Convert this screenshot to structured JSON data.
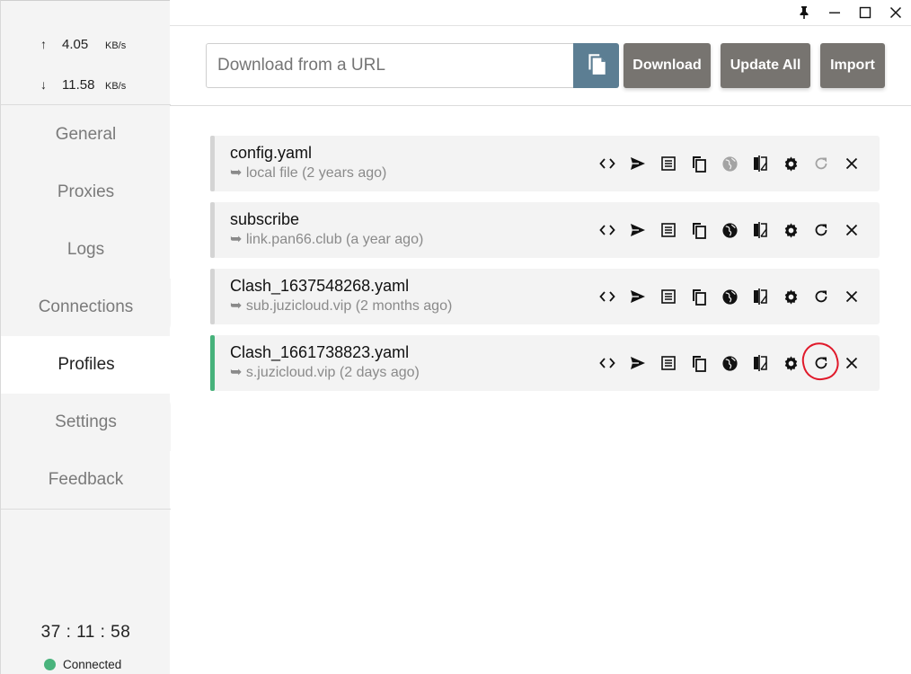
{
  "window": {
    "controls": [
      {
        "name": "pin-icon",
        "glyph": "📌"
      },
      {
        "name": "minimize-icon",
        "glyph": "—"
      },
      {
        "name": "maximize-icon",
        "glyph": "☐"
      },
      {
        "name": "close-icon",
        "glyph": "✕"
      }
    ]
  },
  "traffic": {
    "up_arrow": "↑",
    "up_value": "4.05",
    "up_unit": "KB/s",
    "down_arrow": "↓",
    "down_value": "11.58",
    "down_unit": "KB/s"
  },
  "nav": {
    "items": [
      {
        "label": "General"
      },
      {
        "label": "Proxies"
      },
      {
        "label": "Logs"
      },
      {
        "label": "Connections"
      },
      {
        "label": "Profiles"
      },
      {
        "label": "Settings"
      },
      {
        "label": "Feedback"
      }
    ],
    "active": "Profiles"
  },
  "footer": {
    "clock": "37 : 11 : 58",
    "status": "Connected",
    "status_color": "#49b37c"
  },
  "header": {
    "url_placeholder": "Download from a URL",
    "url_value": "",
    "download_label": "Download",
    "update_all_label": "Update All",
    "import_label": "Import",
    "accent_color": "#5c7e93",
    "button_color": "#777470"
  },
  "profiles": [
    {
      "name": "config.yaml",
      "source": "➥ local file (2 years ago)",
      "selected": false,
      "remote": false
    },
    {
      "name": "subscribe",
      "source": "➥ link.pan66.club (a year ago)",
      "selected": false,
      "remote": true
    },
    {
      "name": "Clash_1637548268.yaml",
      "source": "➥ sub.juzicloud.vip (2 months ago)",
      "selected": false,
      "remote": true
    },
    {
      "name": "Clash_1661738823.yaml",
      "source": "➥ s.juzicloud.vip (2 days ago)",
      "selected": true,
      "remote": true
    }
  ],
  "profile_actions": [
    "code-icon",
    "send-icon",
    "list-icon",
    "copy-icon",
    "globe-icon",
    "compare-icon",
    "gear-icon",
    "refresh-icon",
    "close-icon"
  ],
  "annotation_color": "#e0192a",
  "selected_color": "#47b27b"
}
